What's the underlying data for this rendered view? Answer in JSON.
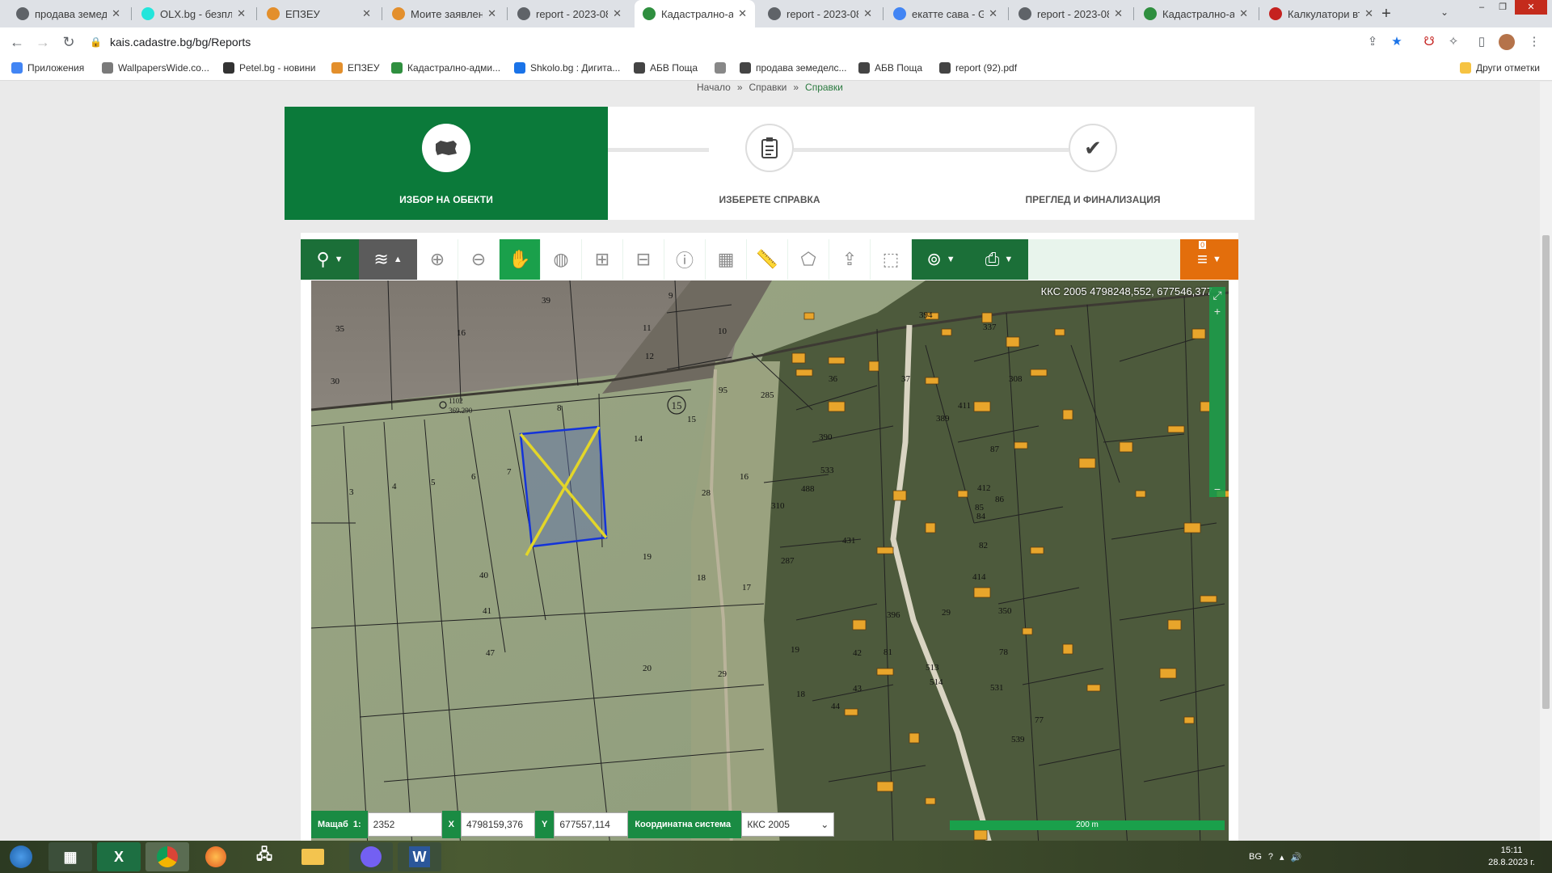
{
  "browser": {
    "tabs": [
      {
        "title": "продава земеде",
        "color": "#5f6368"
      },
      {
        "title": "OLX.bg - безпла",
        "color": "#23e5db"
      },
      {
        "title": "ЕПЗЕУ",
        "color": "#e38f2c"
      },
      {
        "title": "Моите заявлени",
        "color": "#e38f2c"
      },
      {
        "title": "report - 2023-08",
        "color": "#5f6368"
      },
      {
        "title": "Кадастрално-ад",
        "color": "#2f8f3f"
      },
      {
        "title": "report - 2023-08",
        "color": "#5f6368"
      },
      {
        "title": "екатте сава - Go",
        "color": "#4285f4"
      },
      {
        "title": "report - 2023-08",
        "color": "#5f6368"
      },
      {
        "title": "Кадастрално-ад",
        "color": "#2f8f3f"
      },
      {
        "title": "Калкулатори въ",
        "color": "#c5221f"
      }
    ],
    "active_tab": 5,
    "url": "kais.cadastre.bg/bg/Reports",
    "bookmarks": [
      {
        "label": "Приложения"
      },
      {
        "label": "WallpapersWide.co..."
      },
      {
        "label": "Petel.bg - новини"
      },
      {
        "label": "ЕПЗЕУ"
      },
      {
        "label": "Кадастрално-адми..."
      },
      {
        "label": "Shkolo.bg : Дигита..."
      },
      {
        "label": "АБВ Поща"
      },
      {
        "label": ""
      },
      {
        "label": "продава земеделс..."
      },
      {
        "label": "АБВ Поща"
      },
      {
        "label": "report (92).pdf"
      }
    ],
    "other_bookmarks": "Други отметки"
  },
  "breadcrumb": {
    "home": "Начало",
    "sep": "»",
    "level1": "Справки",
    "current": "Справки"
  },
  "wizard": {
    "steps": [
      {
        "label": "ИЗБОР НА ОБЕКТИ",
        "icon": "bulgaria-map-icon"
      },
      {
        "label": "ИЗБЕРЕТЕ СПРАВКА",
        "icon": "clipboard-icon"
      },
      {
        "label": "ПРЕГЛЕД И ФИНАЛИЗАЦИЯ",
        "icon": "checkmark-icon"
      }
    ]
  },
  "map": {
    "top_coordinates": "ККС 2005 4798248,552, 677546,377",
    "layer_badge": "0",
    "scale_label": "Мащаб",
    "scale_prefix": "1:",
    "scale_value": "2352",
    "x_label": "X",
    "x_value": "4798159,376",
    "y_label": "Y",
    "y_value": "677557,114",
    "crs_label": "Координатна система",
    "crs_value": "ККС 2005",
    "scalebar": "200 m",
    "parcel_labels": [
      "39",
      "35",
      "16",
      "9",
      "11",
      "10",
      "12",
      "30",
      "8",
      "15",
      "14",
      "95",
      "285",
      "3",
      "4",
      "5",
      "6",
      "7",
      "28",
      "16",
      "310",
      "488",
      "19",
      "40",
      "18",
      "17",
      "287",
      "41",
      "47",
      "20",
      "29",
      "19",
      "18",
      "36",
      "37",
      "390",
      "533",
      "431",
      "412",
      "87",
      "85",
      "86",
      "84",
      "82",
      "308",
      "337",
      "394",
      "411",
      "389",
      "414",
      "513",
      "514",
      "531",
      "78",
      "77",
      "539",
      "42",
      "43",
      "44",
      "396",
      "81",
      "350",
      "29"
    ],
    "cadastral_point": {
      "id": "1102",
      "elev": "369.290"
    },
    "district_number": "15"
  },
  "taskbar": {
    "lang": "BG",
    "time": "15:11",
    "date": "28.8.2023 г."
  }
}
